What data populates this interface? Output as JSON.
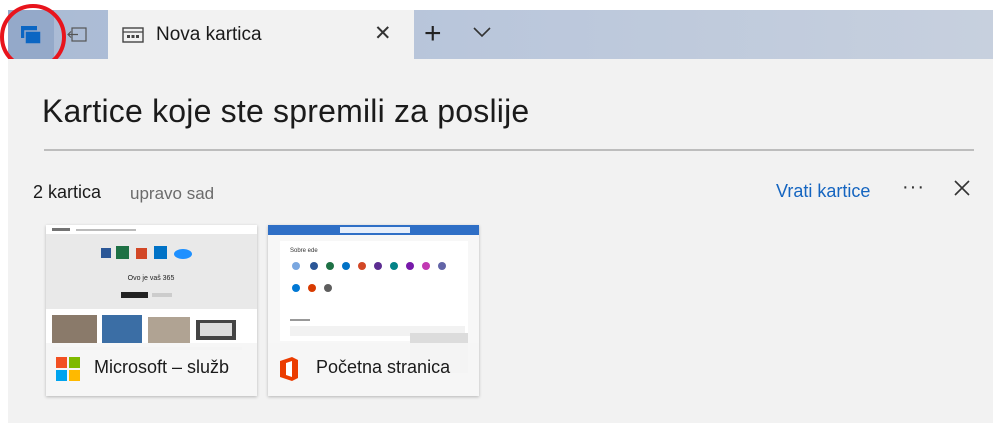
{
  "tabbar": {
    "tab_title": "Nova kartica",
    "close_glyph": "✕",
    "new_tab_glyph": "+",
    "icons": [
      "tabs-aside-icon",
      "set-tabs-aside-icon",
      "page-favicon",
      "close-icon",
      "plus-icon",
      "chevron-down-icon"
    ]
  },
  "page": {
    "heading": "Kartice koje ste spremili za poslije"
  },
  "group": {
    "count": "2 kartica",
    "time": "upravo sad",
    "restore_label": "Vrati kartice",
    "more_glyph": "···"
  },
  "cards": [
    {
      "title": "Microsoft – služb",
      "thumb_heading": "Ovo je vaš 365"
    },
    {
      "title": "Početna stranica",
      "thumb_heading": "Sobre ede"
    }
  ],
  "colors": {
    "accent": "#1565c0",
    "highlight": "#e8141c",
    "tab_active": "#f2f2f2",
    "background": "#f2f2f2"
  }
}
